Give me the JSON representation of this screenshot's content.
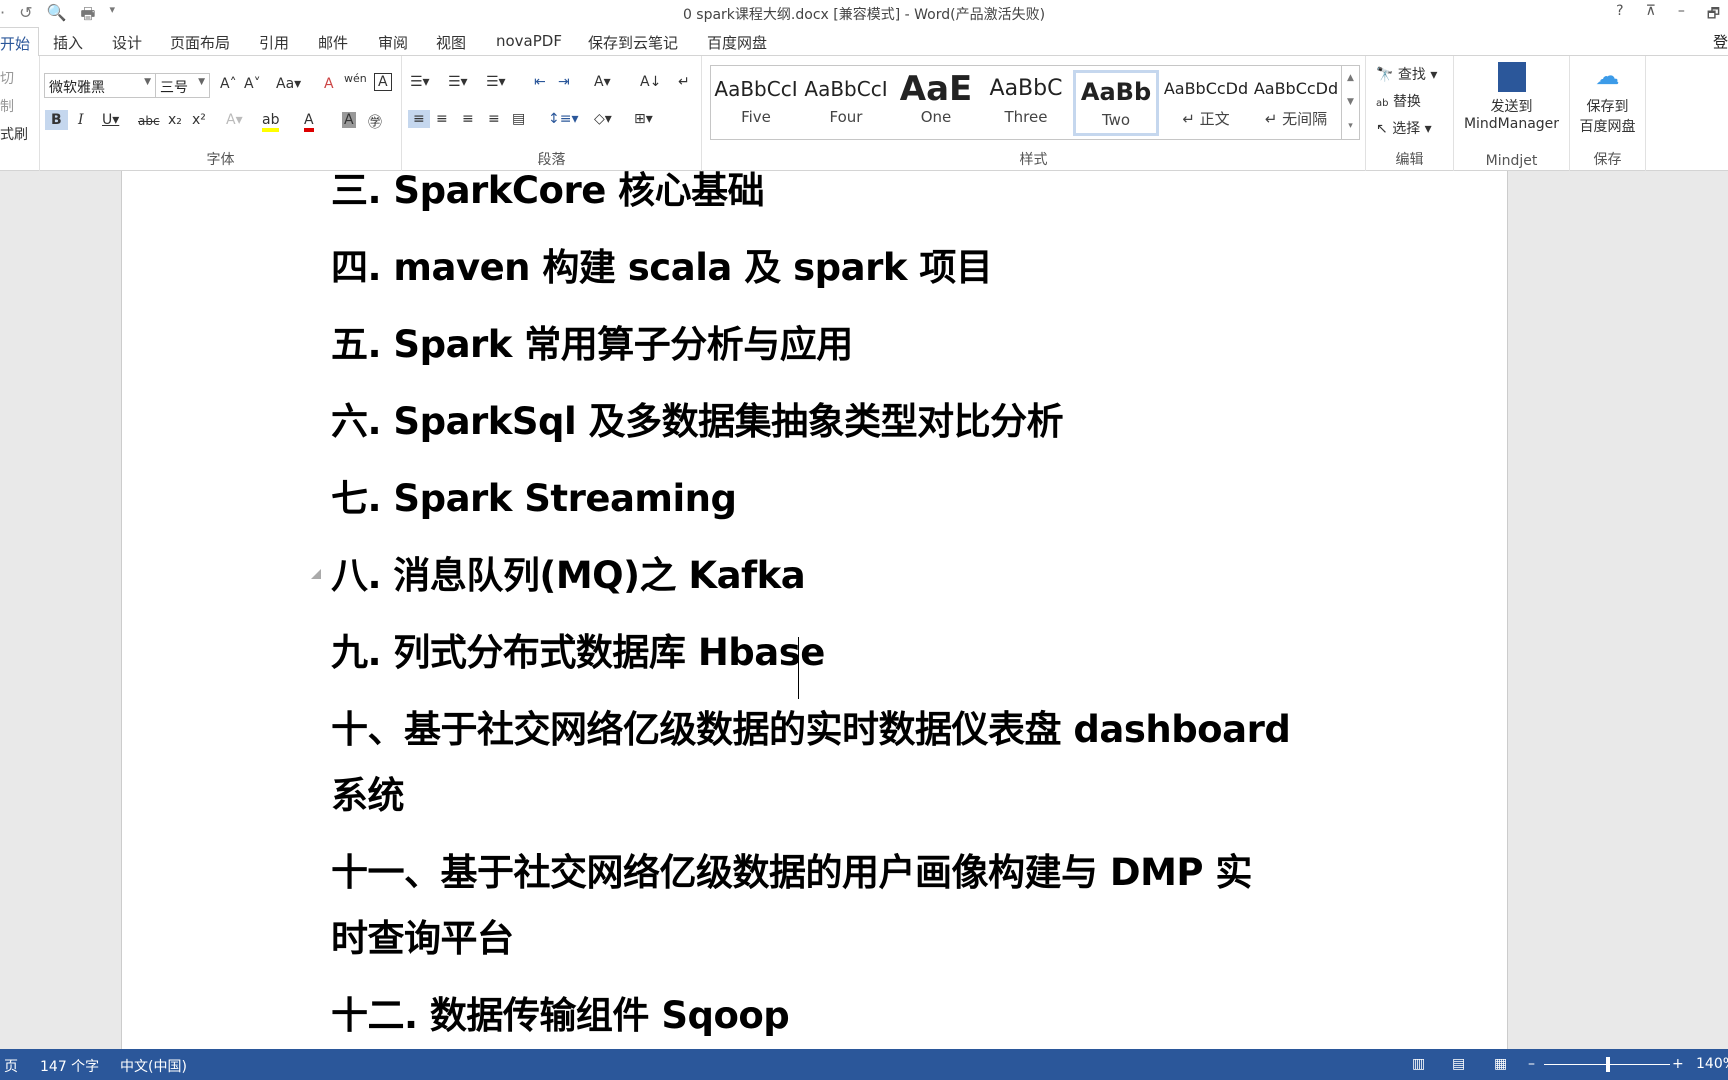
{
  "title": "0 spark课程大纲.docx [兼容模式] - Word(产品激活失败)",
  "window_buttons": [
    "?",
    "⊼",
    "–",
    "🗗"
  ],
  "tabs": [
    "开始",
    "插入",
    "设计",
    "页面布局",
    "引用",
    "邮件",
    "审阅",
    "视图",
    "novaPDF",
    "保存到云笔记",
    "百度网盘"
  ],
  "login": "登",
  "clipboard": {
    "cut": "切",
    "copy": "制",
    "format": "式刷"
  },
  "font": {
    "name": "微软雅黑",
    "size": "三号",
    "group": "字体"
  },
  "paragraph": {
    "group": "段落"
  },
  "styles": {
    "group": "样式",
    "items": [
      {
        "preview": "AaBbCcI",
        "name": "Five"
      },
      {
        "preview": "AaBbCcI",
        "name": "Four"
      },
      {
        "preview": "AaE",
        "name": "One"
      },
      {
        "preview": "AaBbC",
        "name": "Three"
      },
      {
        "preview": "AaBb",
        "name": "Two"
      },
      {
        "preview": "AaBbCcDd",
        "name": "↵ 正文"
      },
      {
        "preview": "AaBbCcDd",
        "name": "↵ 无间隔"
      }
    ]
  },
  "editing": {
    "find": "查找",
    "replace": "替换",
    "select": "选择",
    "group": "编辑"
  },
  "mindjet": {
    "send": "发送到",
    "app": "MindManager",
    "group": "Mindjet"
  },
  "save": {
    "label1": "保存到",
    "label2": "百度网盘",
    "group": "保存"
  },
  "document": {
    "paragraphs": [
      "三. SparkCore 核心基础",
      "四. maven 构建 scala 及 spark 项目",
      "五. Spark 常用算子分析与应用",
      "六. SparkSql 及多数据集抽象类型对比分析",
      "七. Spark Streaming",
      "八. 消息队列(MQ)之 Kafka",
      "九. 列式分布式数据库 Hbase",
      "十、基于社交网络亿级数据的实时数据仪表盘 dashboard 系统",
      "十一、基于社交网络亿级数据的用户画像构建与 DMP 实时查询平台",
      "十二. 数据传输组件 Sqoop"
    ]
  },
  "status": {
    "page": "页",
    "words": "147 个字",
    "language": "中文(中国)",
    "zoom": "140%"
  },
  "colors": {
    "statusbar": "#2b579a",
    "accent": "#2b579a"
  }
}
